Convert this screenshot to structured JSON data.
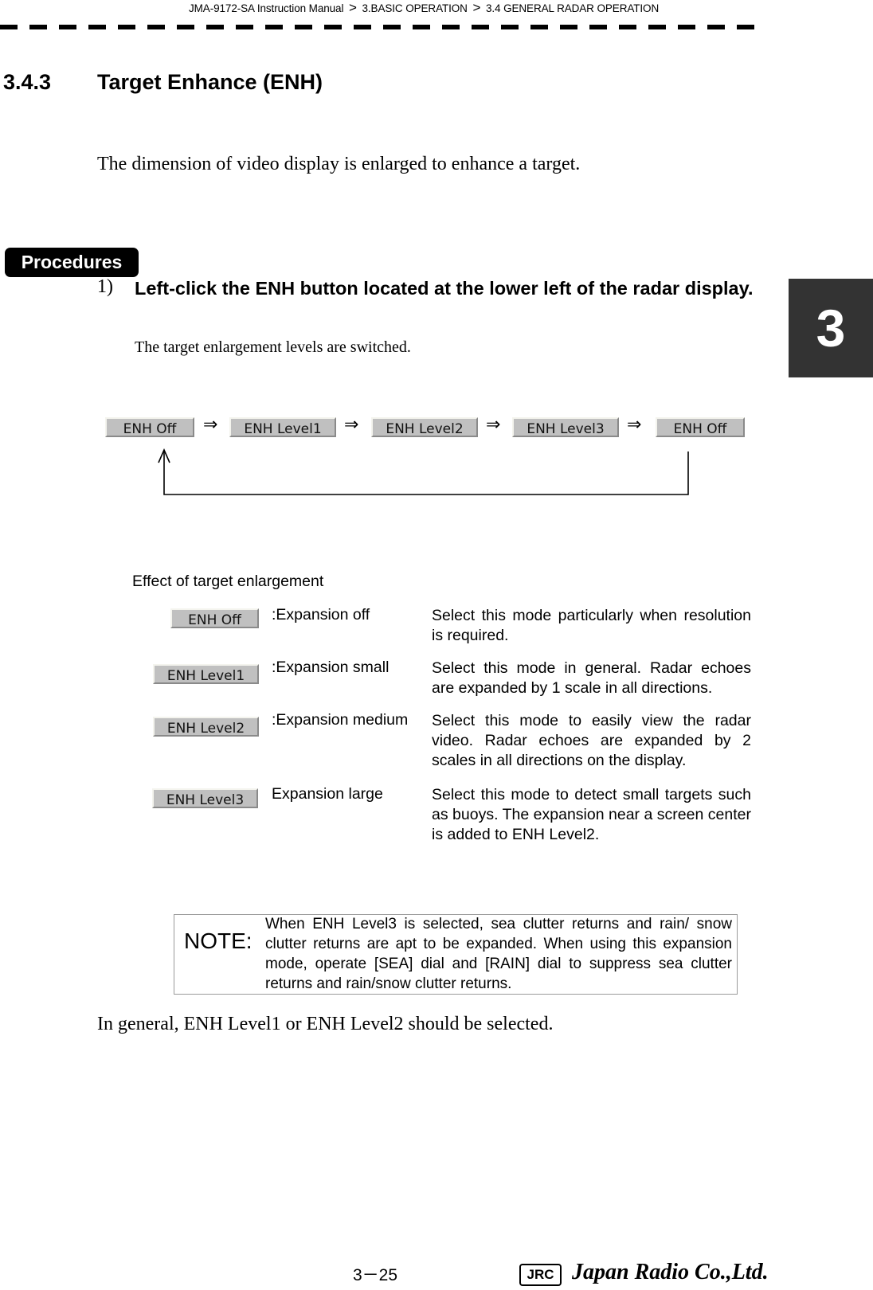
{
  "header": {
    "breadcrumb": [
      "JMA-9172-SA Instruction Manual",
      "3.BASIC OPERATION",
      "3.4  GENERAL RADAR OPERATION"
    ],
    "separator": ">"
  },
  "section": {
    "number": "3.4.3",
    "title": "Target Enhance (ENH)",
    "intro": "The dimension of video display is enlarged to enhance a target."
  },
  "procedures": {
    "badge": "Procedures",
    "steps": [
      {
        "number": "1)",
        "instruction": " Left-click the  ENH  button located at the lower left of the radar display.",
        "result": "The target enlargement levels are switched."
      }
    ]
  },
  "cycle": {
    "buttons": [
      "ENH Off",
      "ENH Level1",
      "ENH Level2",
      "ENH Level3",
      "ENH Off"
    ],
    "arrow": "⇒"
  },
  "effects": {
    "title": "Effect of target enlargement",
    "rows": [
      {
        "button": "ENH Off",
        "label": ":Expansion off",
        "description": "Select this mode particularly when resolution is required."
      },
      {
        "button": "ENH Level1",
        "label": ":Expansion small",
        "description": "Select this mode in general. Radar echoes are expanded by 1 scale in all directions."
      },
      {
        "button": "ENH Level2",
        "label": ":Expansion medium",
        "description": "Select this mode to easily view the radar video. Radar echoes are expanded by 2 scales in all directions on the display."
      },
      {
        "button": "ENH Level3",
        "label": "Expansion large",
        "description": "Select this mode to detect small targets such as buoys. The expansion near a screen center is added to ENH Level2."
      }
    ]
  },
  "note": {
    "label": "NOTE:",
    "text": "When ENH Level3 is selected, sea clutter returns and rain/ snow clutter returns are apt to be expanded. When using this expansion mode, operate [SEA] dial and [RAIN] dial to suppress sea clutter returns and rain/snow clutter returns."
  },
  "closing": "In general, ENH Level1 or ENH Level2 should be selected.",
  "chapter_tab": "3",
  "footer": {
    "page": "3－25",
    "logo_mark": "JRC",
    "company": "Japan Radio Co.,Ltd."
  }
}
